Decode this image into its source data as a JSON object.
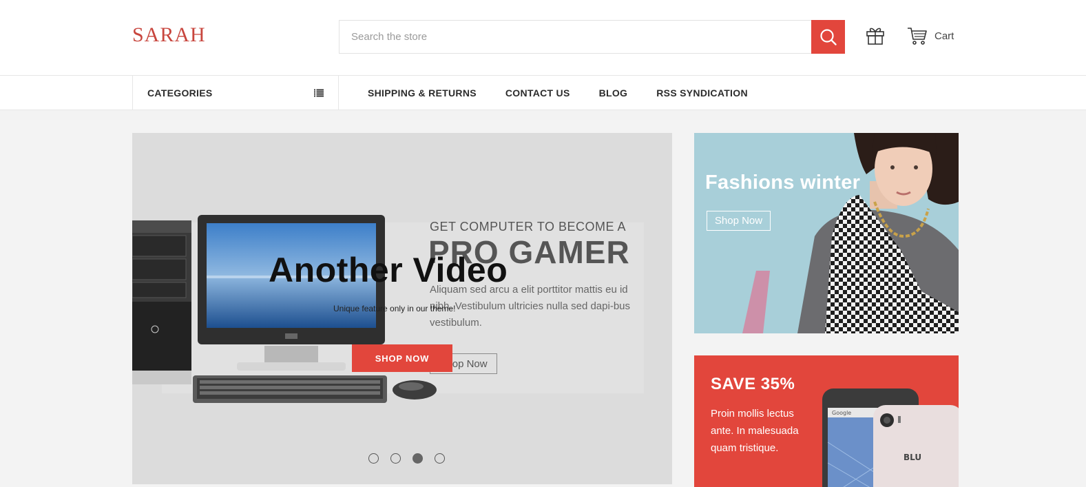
{
  "brand": {
    "logo": "SARAH",
    "accent_color": "#e2463c"
  },
  "header": {
    "search_placeholder": "Search the store",
    "search_icon": "search-icon",
    "gift_icon": "gift-icon",
    "cart_icon": "cart-icon",
    "cart_label": "Cart"
  },
  "nav": {
    "categories_label": "CATEGORIES",
    "categories_icon": "list-icon",
    "links": [
      "SHIPPING & RETURNS",
      "CONTACT US",
      "BLOG",
      "RSS SYNDICATION"
    ]
  },
  "hero": {
    "kicker": "GET COMPUTER TO BECOME A",
    "headline": "PRO GAMER",
    "description": "Aliquam sed arcu a elit porttitor mattis eu id nibh. Vestibulum ultricies nulla sed dapi-bus vestibulum.",
    "ghost_button": "Shop Now",
    "title": "Another Video",
    "subtitle": "Unique feature only in our theme!",
    "cta": "SHOP NOW",
    "slides_total": 4,
    "active_slide": 3
  },
  "banners": {
    "fashion": {
      "title": "Fashions winter",
      "button": "Shop Now"
    },
    "save": {
      "title": "SAVE 35%",
      "text": "Proin mollis lectus ante. In malesuada quam tristique.",
      "phone_brand": "BLU",
      "phone_screen_label": "Google"
    }
  }
}
